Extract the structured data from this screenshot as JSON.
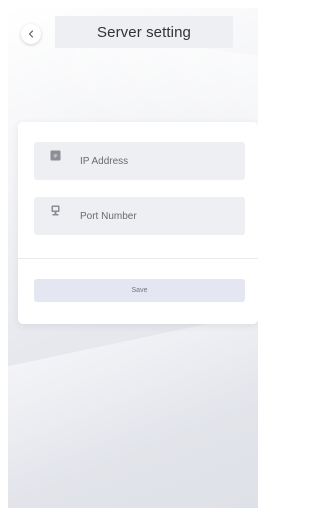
{
  "header": {
    "back_label": "<",
    "title": "Server setting"
  },
  "form": {
    "ip_address": {
      "placeholder": "IP Address",
      "value": "",
      "icon": "ip-icon"
    },
    "port_number": {
      "placeholder": "Port Number",
      "value": "",
      "icon": "port-icon"
    },
    "save_label": "Save"
  },
  "colors": {
    "background": "#e6e8ee",
    "card": "#ffffff",
    "field": "#eeeff3",
    "save_button": "#e4e6f2",
    "title_text": "#333333"
  }
}
